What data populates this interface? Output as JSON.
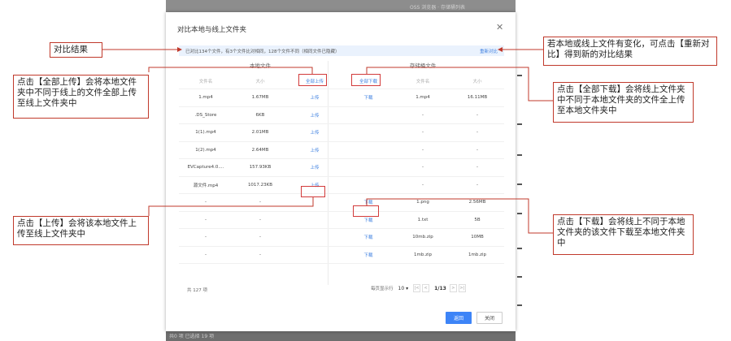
{
  "background": {
    "bg_top_text": "OSS 浏览器 · 存储桶列表",
    "bg_bottom_text": "共0 项 已选择 19 项"
  },
  "dialog": {
    "title": "对比本地与线上文件夹",
    "close_icon": "close-icon",
    "info_text": "已对比134个文件，有3个文件比对相同，128个文件不同（相同文件已隐藏）",
    "recompare_link": "重新对比",
    "local_section_title": "本地文件",
    "remote_section_title": "存储桶文件",
    "headers": {
      "local_name": "文件名",
      "local_size": "大小",
      "upload_all": "全部上传",
      "download_all": "全部下载",
      "remote_name": "文件名",
      "remote_size": "大小"
    },
    "rows": [
      {
        "local_name": "1.mp4",
        "local_size": "1.67MB",
        "local_action": "上传",
        "remote_action": "下载",
        "remote_name": "1.mp4",
        "remote_size": "16.11MB"
      },
      {
        "local_name": ".DS_Store",
        "local_size": "6KB",
        "local_action": "上传",
        "remote_action": "",
        "remote_name": "-",
        "remote_size": "-"
      },
      {
        "local_name": "1(1).mp4",
        "local_size": "2.01MB",
        "local_action": "上传",
        "remote_action": "",
        "remote_name": "-",
        "remote_size": "-"
      },
      {
        "local_name": "1(2).mp4",
        "local_size": "2.64MB",
        "local_action": "上传",
        "remote_action": "",
        "remote_name": "-",
        "remote_size": "-"
      },
      {
        "local_name": "EVCapture4.0....",
        "local_size": "157.93KB",
        "local_action": "上传",
        "remote_action": "",
        "remote_name": "-",
        "remote_size": "-"
      },
      {
        "local_name": "源文件.mp4",
        "local_size": "1017.23KB",
        "local_action": "上传",
        "remote_action": "",
        "remote_name": "-",
        "remote_size": "-"
      },
      {
        "local_name": "-",
        "local_size": "-",
        "local_action": "",
        "remote_action": "下载",
        "remote_name": "1.png",
        "remote_size": "2.56MB"
      },
      {
        "local_name": "-",
        "local_size": "-",
        "local_action": "",
        "remote_action": "下载",
        "remote_name": "1.txt",
        "remote_size": "5B"
      },
      {
        "local_name": "-",
        "local_size": "-",
        "local_action": "",
        "remote_action": "下载",
        "remote_name": "10mb.zip",
        "remote_size": "10MB"
      },
      {
        "local_name": "-",
        "local_size": "-",
        "local_action": "",
        "remote_action": "下载",
        "remote_name": "1mb.zip",
        "remote_size": "1mb.zip"
      }
    ],
    "total_count": "共 127 项",
    "pager": {
      "per_page_label": "每页显示行",
      "per_page_value": "10",
      "first_icon": "|<",
      "prev_icon": "<",
      "page_text": "1/13",
      "next_icon": ">",
      "last_icon": ">|"
    },
    "buttons": {
      "back": "返回",
      "close": "关闭"
    }
  },
  "callouts": {
    "compare_result": "对比结果",
    "upload_all": "点击【全部上传】会将本地文件夹中不同于线上的文件全部上传至线上文件夹中",
    "upload_one": "点击【上传】会将该本地文件上传至线上文件夹中",
    "recompare": "若本地或线上文件有变化，可点击【重新对比】得到新的对比结果",
    "download_all": "点击【全部下载】会将线上文件夹中不同于本地文件夹的文件全上传至本地文件夹中",
    "download_one": "点击【下载】会将线上不同于本地文件夹的该文件下载至本地文件夹中"
  },
  "colors": {
    "accent": "#3c7fe0",
    "callout_border": "#c0392b",
    "primary_button": "#3d84f7"
  }
}
